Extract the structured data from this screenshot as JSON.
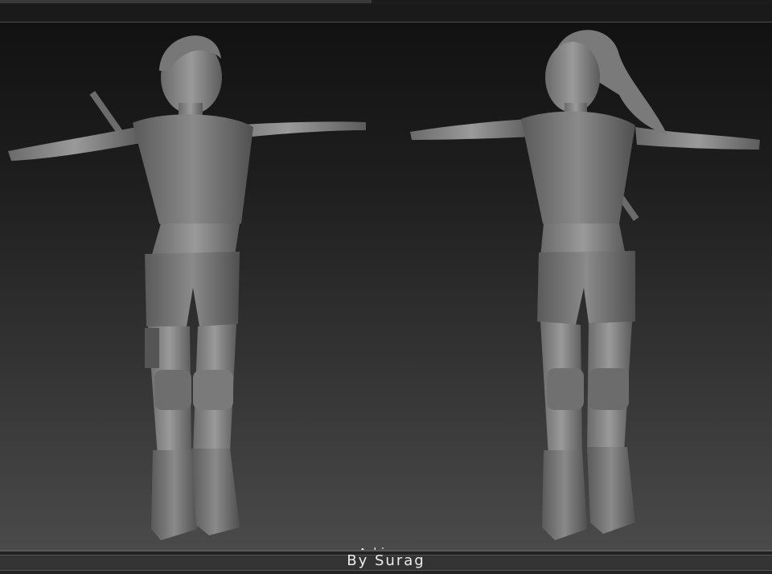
{
  "title": "Alice",
  "byline": "By Surag",
  "models": [
    {
      "name": "front-view-model"
    },
    {
      "name": "three-quarter-view-model"
    }
  ]
}
